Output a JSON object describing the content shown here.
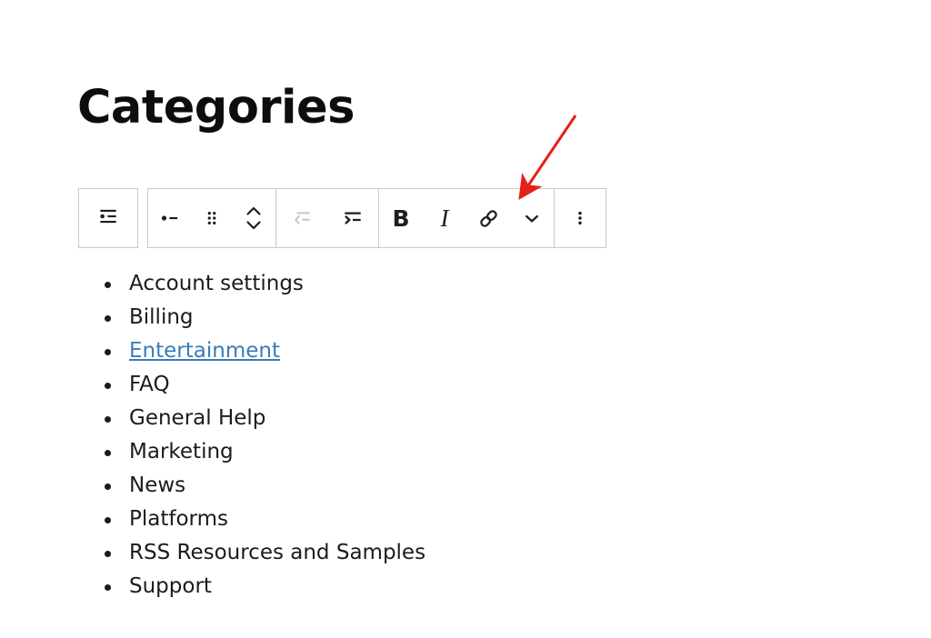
{
  "page": {
    "title": "Categories"
  },
  "toolbar": {
    "block_switcher": {
      "label": "List",
      "icon": "list-view-icon"
    },
    "groups": [
      {
        "name": "block-controls",
        "buttons": [
          {
            "label": "List",
            "icon": "bullet-list-icon",
            "state": "enabled"
          },
          {
            "label": "Drag",
            "icon": "drag-handle-icon",
            "state": "enabled"
          },
          {
            "label": "Move up or down",
            "icon": "move-up-down-icon",
            "state": "enabled"
          }
        ]
      },
      {
        "name": "indentation-controls",
        "buttons": [
          {
            "label": "Outdent",
            "icon": "outdent-icon",
            "state": "disabled"
          },
          {
            "label": "Indent",
            "icon": "indent-icon",
            "state": "enabled"
          }
        ]
      },
      {
        "name": "formatting-controls",
        "buttons": [
          {
            "label": "B",
            "icon": "bold-icon",
            "state": "enabled"
          },
          {
            "label": "I",
            "icon": "italic-icon",
            "state": "enabled"
          },
          {
            "label": "Link",
            "icon": "link-icon",
            "state": "enabled"
          },
          {
            "label": "More rich text controls",
            "icon": "chevron-down-icon",
            "state": "enabled"
          }
        ]
      },
      {
        "name": "options-control",
        "buttons": [
          {
            "label": "Options",
            "icon": "vertical-ellipsis-icon",
            "state": "enabled"
          }
        ]
      }
    ]
  },
  "list": {
    "items": [
      {
        "text": "Account settings",
        "is_link": false
      },
      {
        "text": "Billing",
        "is_link": false
      },
      {
        "text": "Entertainment",
        "is_link": true
      },
      {
        "text": "FAQ",
        "is_link": false
      },
      {
        "text": "General Help",
        "is_link": false
      },
      {
        "text": "Marketing",
        "is_link": false
      },
      {
        "text": "News",
        "is_link": false
      },
      {
        "text": "Platforms",
        "is_link": false
      },
      {
        "text": "RSS Resources and Samples",
        "is_link": false
      },
      {
        "text": "Support",
        "is_link": false
      }
    ]
  },
  "annotation": {
    "type": "arrow",
    "color": "#e32119",
    "points_to": "link-icon"
  },
  "colors": {
    "link": "#3a7cb8",
    "text": "#1b1b1b",
    "toolbar_border": "#c9c9c9",
    "icon_enabled": "#1e1e1e",
    "icon_disabled": "#c6c6c6",
    "annotation": "#e32119"
  }
}
